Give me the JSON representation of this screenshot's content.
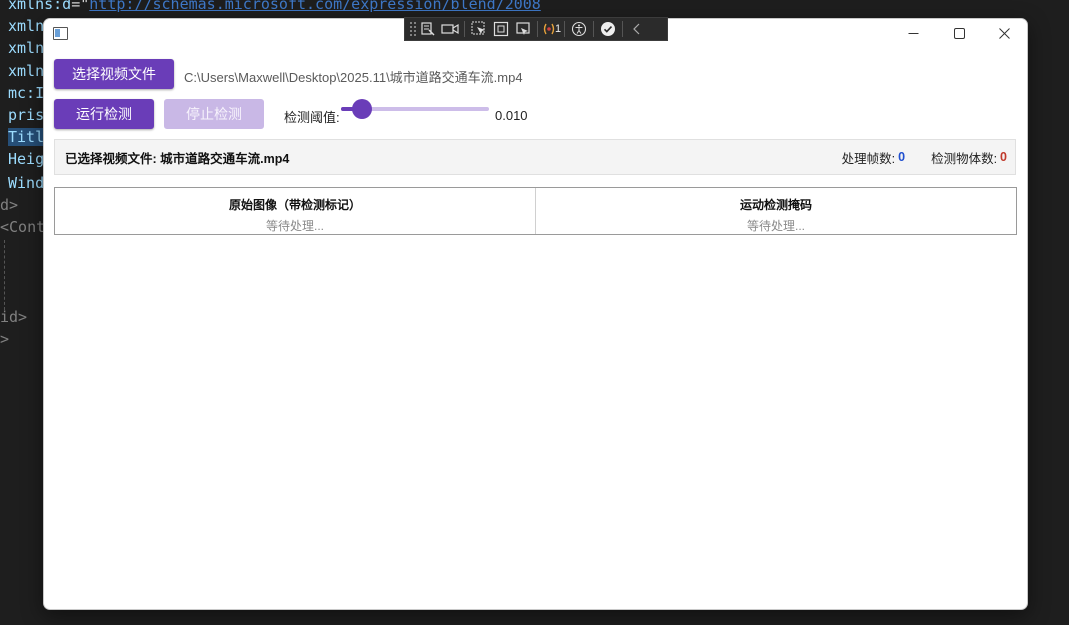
{
  "editor": {
    "lines": [
      {
        "attr": "xmlns:d",
        "eq": "=\"",
        "val": "http://schemas.microsoft.com/expression/blend/2008"
      },
      {
        "attr": "xmln",
        "eq": "",
        "val": ""
      },
      {
        "attr": "xmln",
        "eq": "",
        "val": ""
      },
      {
        "attr": "xmln",
        "eq": "",
        "val": ""
      },
      {
        "attr": "mc:I",
        "eq": "",
        "val": ""
      },
      {
        "attr": "pris",
        "eq": "",
        "val": ""
      },
      {
        "attr": "Titl",
        "eq": "",
        "val": ""
      },
      {
        "attr": "Heig",
        "eq": "",
        "val": ""
      },
      {
        "attr": "Wind",
        "eq": "",
        "val": ""
      }
    ],
    "tag_d": "d>",
    "tag_cont": "<Cont",
    "tag_id": "id>",
    "tag_caret": ">"
  },
  "debug_toolbar": {
    "binding_count": "1",
    "icons": [
      "select-element-icon",
      "live-preview-icon",
      "pointer-icon",
      "display-layout-icon",
      "track-focus-icon",
      "binding-failures-icon",
      "accessibility-icon",
      "check-icon",
      "collapse-chevron-icon"
    ]
  },
  "window": {
    "title": "",
    "controls": {
      "minimize": "—",
      "maximize": "☐",
      "close": "✕"
    }
  },
  "toolbar": {
    "select_video_label": "选择视频文件",
    "file_path": "C:\\Users\\Maxwell\\Desktop\\2025.11\\城市道路交通车流.mp4",
    "run_label": "运行检测",
    "stop_label": "停止检测",
    "threshold_label": "检测阈值:",
    "threshold_value": "0.010",
    "threshold_fraction": 0.14
  },
  "status": {
    "selected_text": "已选择视频文件: 城市道路交通车流.mp4",
    "frames_label": "处理帧数:",
    "frames_value": "0",
    "objects_label": "检测物体数:",
    "objects_value": "0"
  },
  "panels": [
    {
      "title": "原始图像（带检测标记）",
      "status": "等待处理..."
    },
    {
      "title": "运动检测掩码",
      "status": "等待处理..."
    }
  ],
  "colors": {
    "accent": "#6a3db8",
    "accent_disabled": "#c9b8e6",
    "frames_value": "#1f4fcf",
    "objects_value": "#c0392b"
  }
}
